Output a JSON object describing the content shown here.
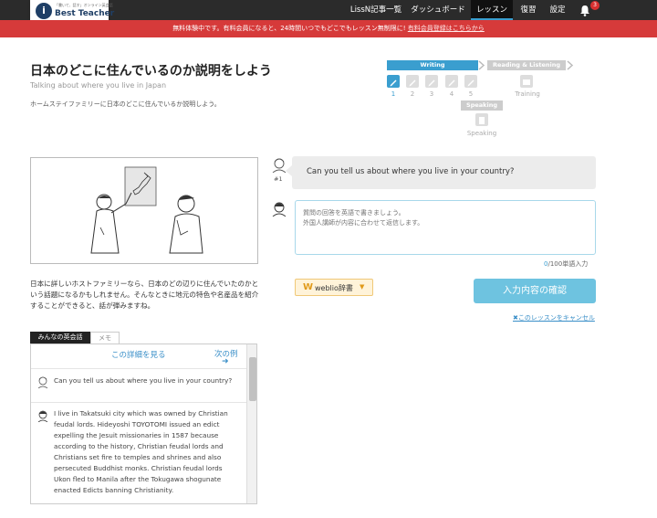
{
  "header": {
    "logo_tagline": "「書いて、話す」オンライン英会話",
    "logo_name": "Best Teacher",
    "nav": [
      "LissN記事一覧",
      "ダッシュボード",
      "レッスン",
      "復習",
      "設定"
    ],
    "notification_count": "3"
  },
  "banner": {
    "text": "無料体験中です。有料会員になると、24時間いつでもどこでもレッスン無制限に!",
    "link": "有料会員登録はこちらから"
  },
  "lesson": {
    "title": "日本のどこに住んでいるのか説明をしよう",
    "subtitle": "Talking about where you live in Japan",
    "description": "ホームステイファミリーに日本のどこに住んでいるか説明しよう。",
    "story": "日本に詳しいホストファミリーなら、日本のどの辺りに住んでいたのかという話題になるかもしれません。そんなときに地元の特色や名産品を紹介することができると、話が弾みますね。"
  },
  "progress": {
    "writing_label": "Writing",
    "reading_label": "Reading & Listening",
    "speaking_label": "Speaking",
    "step_numbers": [
      "1",
      "2",
      "3",
      "4",
      "5"
    ],
    "training_label": "Training",
    "speaking_sub": "Speaking"
  },
  "examples": {
    "tabs": [
      "みんなの英会話",
      "メモ"
    ],
    "detail_link": "この詳細を見る",
    "next_link": "次の例",
    "next_arrow": "➜",
    "question": "Can you tell us about where you live in your country?",
    "answer": "I live in Takatsuki city which was owned by Christian feudal lords. Hideyoshi TOYOTOMI issued an edict expelling the Jesuit missionaries in 1587 because according to the history, Christian feudal lords and Christians set fire to temples and shrines and also persecuted Buddhist monks. Christian feudal lords Ukon fled to Manila after the Tokugawa shogunate enacted Edicts banning Christianity."
  },
  "question": {
    "number": "#1",
    "text": "Can you tell us about where you live in your country?"
  },
  "answer_box": {
    "placeholder": "質問の回答を英語で書きましょう。\n外国人講師が内容に合わせて返信します。",
    "count": "0",
    "limit": "/100単語入力"
  },
  "actions": {
    "weblio_w": "W",
    "weblio_label": "weblio辞書",
    "weblio_caret": "▼",
    "confirm": "入力内容の確認",
    "cancel": "✖このレッスンをキャンセル"
  },
  "colors": {
    "accent": "#3a9ecf",
    "banner": "#d63a3a",
    "confirm": "#6ec3e0",
    "topbar": "#2b2b2b"
  }
}
